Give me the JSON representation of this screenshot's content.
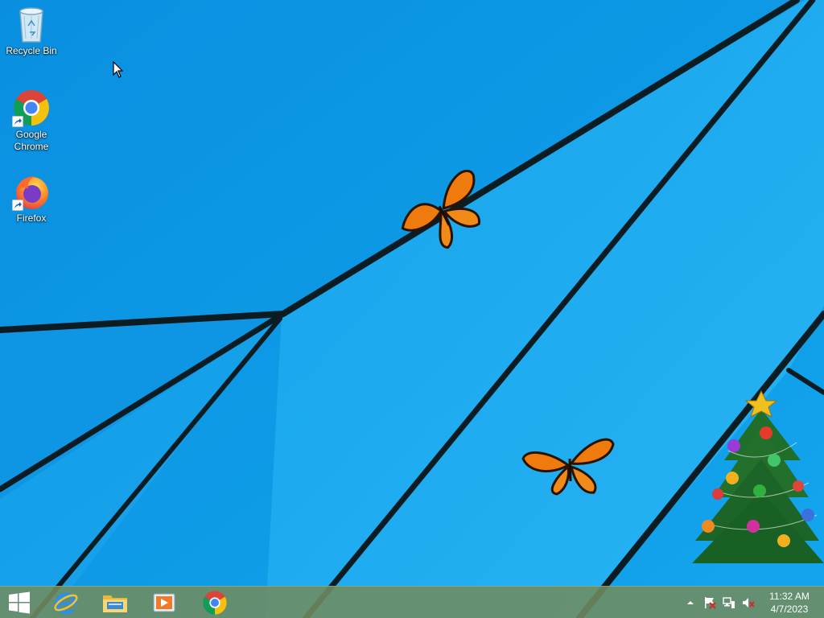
{
  "desktop": {
    "icons": [
      {
        "label": "Recycle Bin",
        "icon": "recycle-bin-icon"
      },
      {
        "label": "Google Chrome",
        "icon": "chrome-icon"
      },
      {
        "label": "Firefox",
        "icon": "firefox-icon"
      }
    ],
    "wallpaper_color": "#13a0e6",
    "decorations": [
      "butterfly",
      "butterfly",
      "christmas-tree"
    ]
  },
  "taskbar": {
    "pinned": [
      {
        "name": "Internet Explorer",
        "icon": "internet-explorer-icon"
      },
      {
        "name": "File Explorer",
        "icon": "file-explorer-icon"
      },
      {
        "name": "Windows Media Player",
        "icon": "media-player-icon"
      },
      {
        "name": "Google Chrome",
        "icon": "chrome-icon"
      }
    ],
    "color": "#708c60"
  },
  "tray": {
    "icons": [
      "show-hidden-icons-icon",
      "action-center-flag-icon",
      "network-icon",
      "volume-muted-icon"
    ],
    "time": "11:32 AM",
    "date": "4/7/2023"
  }
}
